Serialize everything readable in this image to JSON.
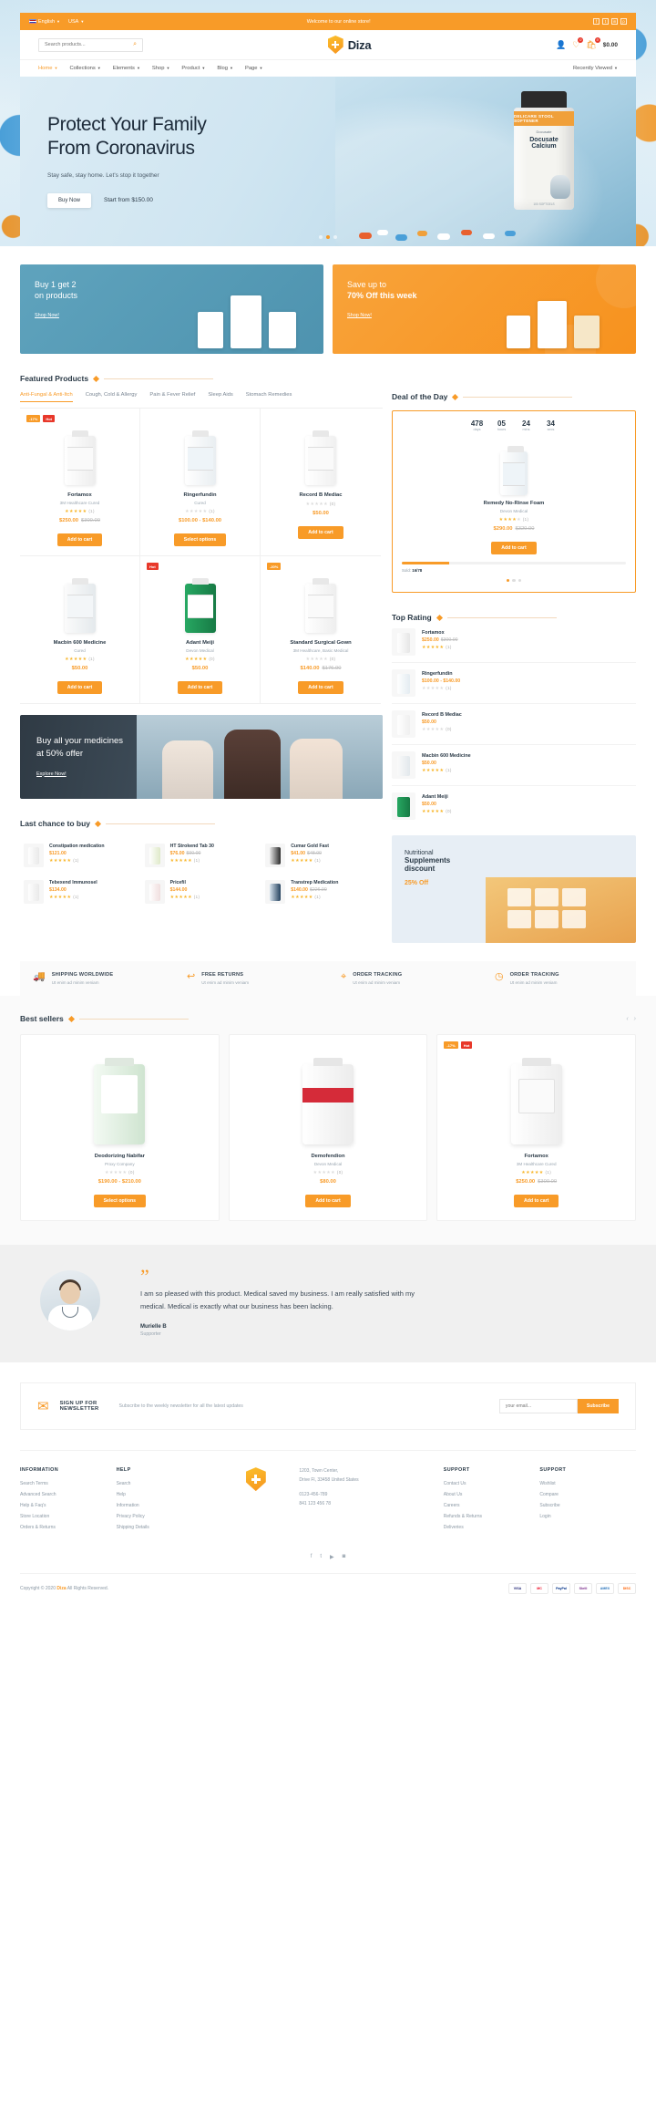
{
  "topbar": {
    "language": "English",
    "country": "USA",
    "welcome": "Welcome to our online store!",
    "social": [
      "f",
      "t",
      "in",
      "p"
    ]
  },
  "header": {
    "search_placeholder": "Search products...",
    "brand": "Diza",
    "wishlist_count": "0",
    "cart_count": "0",
    "cart_total": "$0.00"
  },
  "nav": {
    "items": [
      {
        "label": "Home",
        "active": true
      },
      {
        "label": "Collections",
        "active": false
      },
      {
        "label": "Elements",
        "active": false
      },
      {
        "label": "Shop",
        "active": false
      },
      {
        "label": "Product",
        "active": false
      },
      {
        "label": "Blog",
        "active": false
      },
      {
        "label": "Page",
        "active": false
      }
    ],
    "right_label": "Recently Viewed"
  },
  "hero": {
    "title_line1": "Protect Your Family",
    "title_line2": "From Coronavirus",
    "subtitle": "Stay safe, stay home. Let's stop it together",
    "cta": "Buy Now",
    "price_note": "Start from $150.00",
    "bottle_band": "DELICARE STOOL SOFTENER",
    "bottle_small": "Docusate",
    "bottle_name": "Docusate Calcium",
    "bottle_footer": "100 SOFTGELS"
  },
  "promos": [
    {
      "line1": "Buy 1 get 2",
      "line2": "on products",
      "cta": "Shop Now!",
      "color": "#5fa3bd"
    },
    {
      "line1": "Save up to",
      "line2": "70% Off this week",
      "cta": "Shop Now!",
      "color": "#f7921e"
    }
  ],
  "featured": {
    "title": "Featured Products",
    "tabs": [
      {
        "label": "Anti-Fungal & Anti-Itch",
        "active": true
      },
      {
        "label": "Cough, Cold & Allergy",
        "active": false
      },
      {
        "label": "Pain & Fever Relief",
        "active": false
      },
      {
        "label": "Sleep Aids",
        "active": false
      },
      {
        "label": "Stomach Remedies",
        "active": false
      }
    ],
    "products": [
      {
        "name": "Fortamox",
        "category": "3M Healthcare Cured",
        "rating": 5,
        "reviews": "(1)",
        "price": "$250.00",
        "old_price": "$300.00",
        "button": "Add to cart",
        "badges": [
          {
            "text": "-17%",
            "type": "sale"
          },
          {
            "text": "Hot",
            "type": "hot"
          }
        ],
        "bottle_color": "#ffffff"
      },
      {
        "name": "Ringerfundin",
        "category": "Cured",
        "rating": 0,
        "reviews": "(1)",
        "price": "$100.00 - $140.00",
        "old_price": "",
        "button": "Select options",
        "badges": [],
        "bottle_color": "#f5f7f8"
      },
      {
        "name": "Record B Mediac",
        "category": "",
        "rating": 0,
        "reviews": "(0)",
        "price": "$50.00",
        "old_price": "",
        "button": "Add to cart",
        "badges": [],
        "bottle_color": "#ffffff"
      },
      {
        "name": "Macbin 600 Medicine",
        "category": "Cured",
        "rating": 5,
        "reviews": "(1)",
        "price": "$50.00",
        "old_price": "",
        "button": "Add to cart",
        "badges": [],
        "bottle_color": "#eef1f3"
      },
      {
        "name": "Adant Meiji",
        "category": "Devon Medical",
        "rating": 5,
        "reviews": "(0)",
        "price": "$50.00",
        "old_price": "",
        "button": "Add to cart",
        "badges": [
          {
            "text": "Hot",
            "type": "hot"
          }
        ],
        "bottle_color": "#1f9e5a"
      },
      {
        "name": "Standard Surgical Gown",
        "category": "3M Healthcare, Basic Medical",
        "rating": 0,
        "reviews": "(0)",
        "price": "$140.00",
        "old_price": "$176.00",
        "button": "Add to cart",
        "badges": [
          {
            "text": "-20%",
            "type": "sale"
          }
        ],
        "bottle_color": "#ffffff"
      }
    ]
  },
  "deal": {
    "title": "Deal of the Day",
    "countdown": [
      {
        "value": "478",
        "label": "days"
      },
      {
        "value": "05",
        "label": "hours"
      },
      {
        "value": "24",
        "label": "mins"
      },
      {
        "value": "34",
        "label": "secs"
      }
    ],
    "name": "Remedy No-Rinse Foam",
    "category": "Devon Medical",
    "rating": 4,
    "reviews": "(1)",
    "price": "$290.00",
    "old_price": "$320.00",
    "button": "Add to cart",
    "sold_label": "Sold:",
    "sold_value": "16/78",
    "progress_pct": 21
  },
  "top_rating": {
    "title": "Top Rating",
    "items": [
      {
        "name": "Fortamox",
        "price": "$250.00",
        "old_price": "$300.00",
        "rating": 5,
        "reviews": "(1)"
      },
      {
        "name": "Ringerfundin",
        "price": "$100.00 - $140.00",
        "old_price": "",
        "rating": 0,
        "reviews": "(1)"
      },
      {
        "name": "Record B Mediac",
        "price": "$50.00",
        "old_price": "",
        "rating": 0,
        "reviews": "(0)"
      },
      {
        "name": "Macbin 600 Medicine",
        "price": "$50.00",
        "old_price": "",
        "rating": 5,
        "reviews": "(1)"
      },
      {
        "name": "Adant Meiji",
        "price": "$50.00",
        "old_price": "",
        "rating": 5,
        "reviews": "(0)"
      }
    ]
  },
  "mid_banner": {
    "line1": "Buy all your medicines",
    "line2": "at 50% offer",
    "cta": "Explore Now!"
  },
  "last_chance": {
    "title": "Last chance to buy",
    "items": [
      {
        "name": "Constipation medication",
        "price": "$121.00",
        "old_price": "",
        "rating": 5,
        "reviews": "(1)"
      },
      {
        "name": "HT Strokend Tab 30",
        "price": "$76.00",
        "old_price": "$90.00",
        "rating": 5,
        "reviews": "(1)"
      },
      {
        "name": "Cumar Gold Fast",
        "price": "$41.00",
        "old_price": "$48.00",
        "rating": 5,
        "reviews": "(1)"
      },
      {
        "name": "Tebexend Immunosel",
        "price": "$134.00",
        "old_price": "",
        "rating": 5,
        "reviews": "(1)"
      },
      {
        "name": "Pricefil",
        "price": "$144.00",
        "old_price": "",
        "rating": 5,
        "reviews": "(1)"
      },
      {
        "name": "Transtrep Medication",
        "price": "$140.00",
        "old_price": "$226.00",
        "rating": 5,
        "reviews": "(1)"
      }
    ]
  },
  "nutritional": {
    "line1": "Nutritional",
    "line2": "Supplements",
    "line3": "discount",
    "offer": "25% Off"
  },
  "features": [
    {
      "icon": "truck-icon",
      "title": "SHIPPING WORLDWIDE",
      "subtitle": "Ut enim ad minim veniam"
    },
    {
      "icon": "return-icon",
      "title": "FREE RETURNS",
      "subtitle": "Ut enim ad minim veniam"
    },
    {
      "icon": "location-icon",
      "title": "ORDER TRACKING",
      "subtitle": "Ut enim ad minim veniam"
    },
    {
      "icon": "clock-icon",
      "title": "ORDER TRACKING",
      "subtitle": "Ut enim ad minim veniam"
    }
  ],
  "best_sellers": {
    "title": "Best sellers",
    "products": [
      {
        "name": "Deodorizing Nabifar",
        "category": "Proxy Company",
        "rating": 0,
        "reviews": "(0)",
        "price": "$190.00 - $210.00",
        "old_price": "",
        "button": "Select options",
        "badges": [],
        "bottle_color": "#dff0e0",
        "label_color": "#1f7a3a"
      },
      {
        "name": "Demofendion",
        "category": "Devon Medical",
        "rating": 0,
        "reviews": "(0)",
        "price": "$80.00",
        "old_price": "",
        "button": "Add to cart",
        "badges": [],
        "bottle_color": "#ffffff",
        "label_color": "#cf1f2e"
      },
      {
        "name": "Fortamox",
        "category": "3M Healthcare Cured",
        "rating": 5,
        "reviews": "(1)",
        "price": "$250.00",
        "old_price": "$300.00",
        "button": "Add to cart",
        "badges": [
          {
            "text": "-17%",
            "type": "sale"
          },
          {
            "text": "Hot",
            "type": "hot"
          }
        ],
        "bottle_color": "#fafafa",
        "label_color": "#8a8a8a"
      }
    ]
  },
  "testimonial": {
    "quote_mark": "”",
    "text": "I am so pleased with this product. Medical saved my business. I am really satisfied with my medical. Medical is exactly what our business has been lacking.",
    "author": "Murielle B",
    "role": "Supporter"
  },
  "newsletter": {
    "title_line1": "SIGN UP FOR",
    "title_line2": "NEWSLETTER",
    "subtitle": "Subscribe to the weekly newsletter for all the latest updates",
    "placeholder": "your email...",
    "button": "Subscribe"
  },
  "footer": {
    "columns": [
      {
        "heading": "INFORMATION",
        "links": [
          "Search Terms",
          "Advanced Search",
          "Help & Faq's",
          "Store Location",
          "Orders & Returns"
        ]
      },
      {
        "heading": "HELP",
        "links": [
          "Search",
          "Help",
          "Information",
          "Privacy Policy",
          "Shipping Details"
        ]
      }
    ],
    "address_lines": [
      "1203, Town Center,",
      "Drive Fl, 33458 United States",
      "",
      "0123-456-789",
      "841 123 456 78"
    ],
    "columns_right": [
      {
        "heading": "SUPPORT",
        "links": [
          "Contact Us",
          "About Us",
          "Careers",
          "Refunds & Returns",
          "Deliveries"
        ]
      },
      {
        "heading": "SUPPORT",
        "links": [
          "Wishlist",
          "Compare",
          "Subscribe",
          "Login"
        ]
      }
    ],
    "social": [
      "f",
      "t",
      "in",
      "p"
    ],
    "copyright_pre": "Copyright © 2020 ",
    "copyright_brand": "Diza",
    "copyright_post": " All Rights Reserved.",
    "payments": [
      "VISA",
      "MC",
      "PayPal",
      "Skrill",
      "AMEX",
      "DISC"
    ]
  },
  "colors": {
    "accent": "#f89b28",
    "dark": "#2b3a47",
    "red": "#e8382a",
    "green": "#49b36b",
    "blue": "#5fa3bd"
  }
}
